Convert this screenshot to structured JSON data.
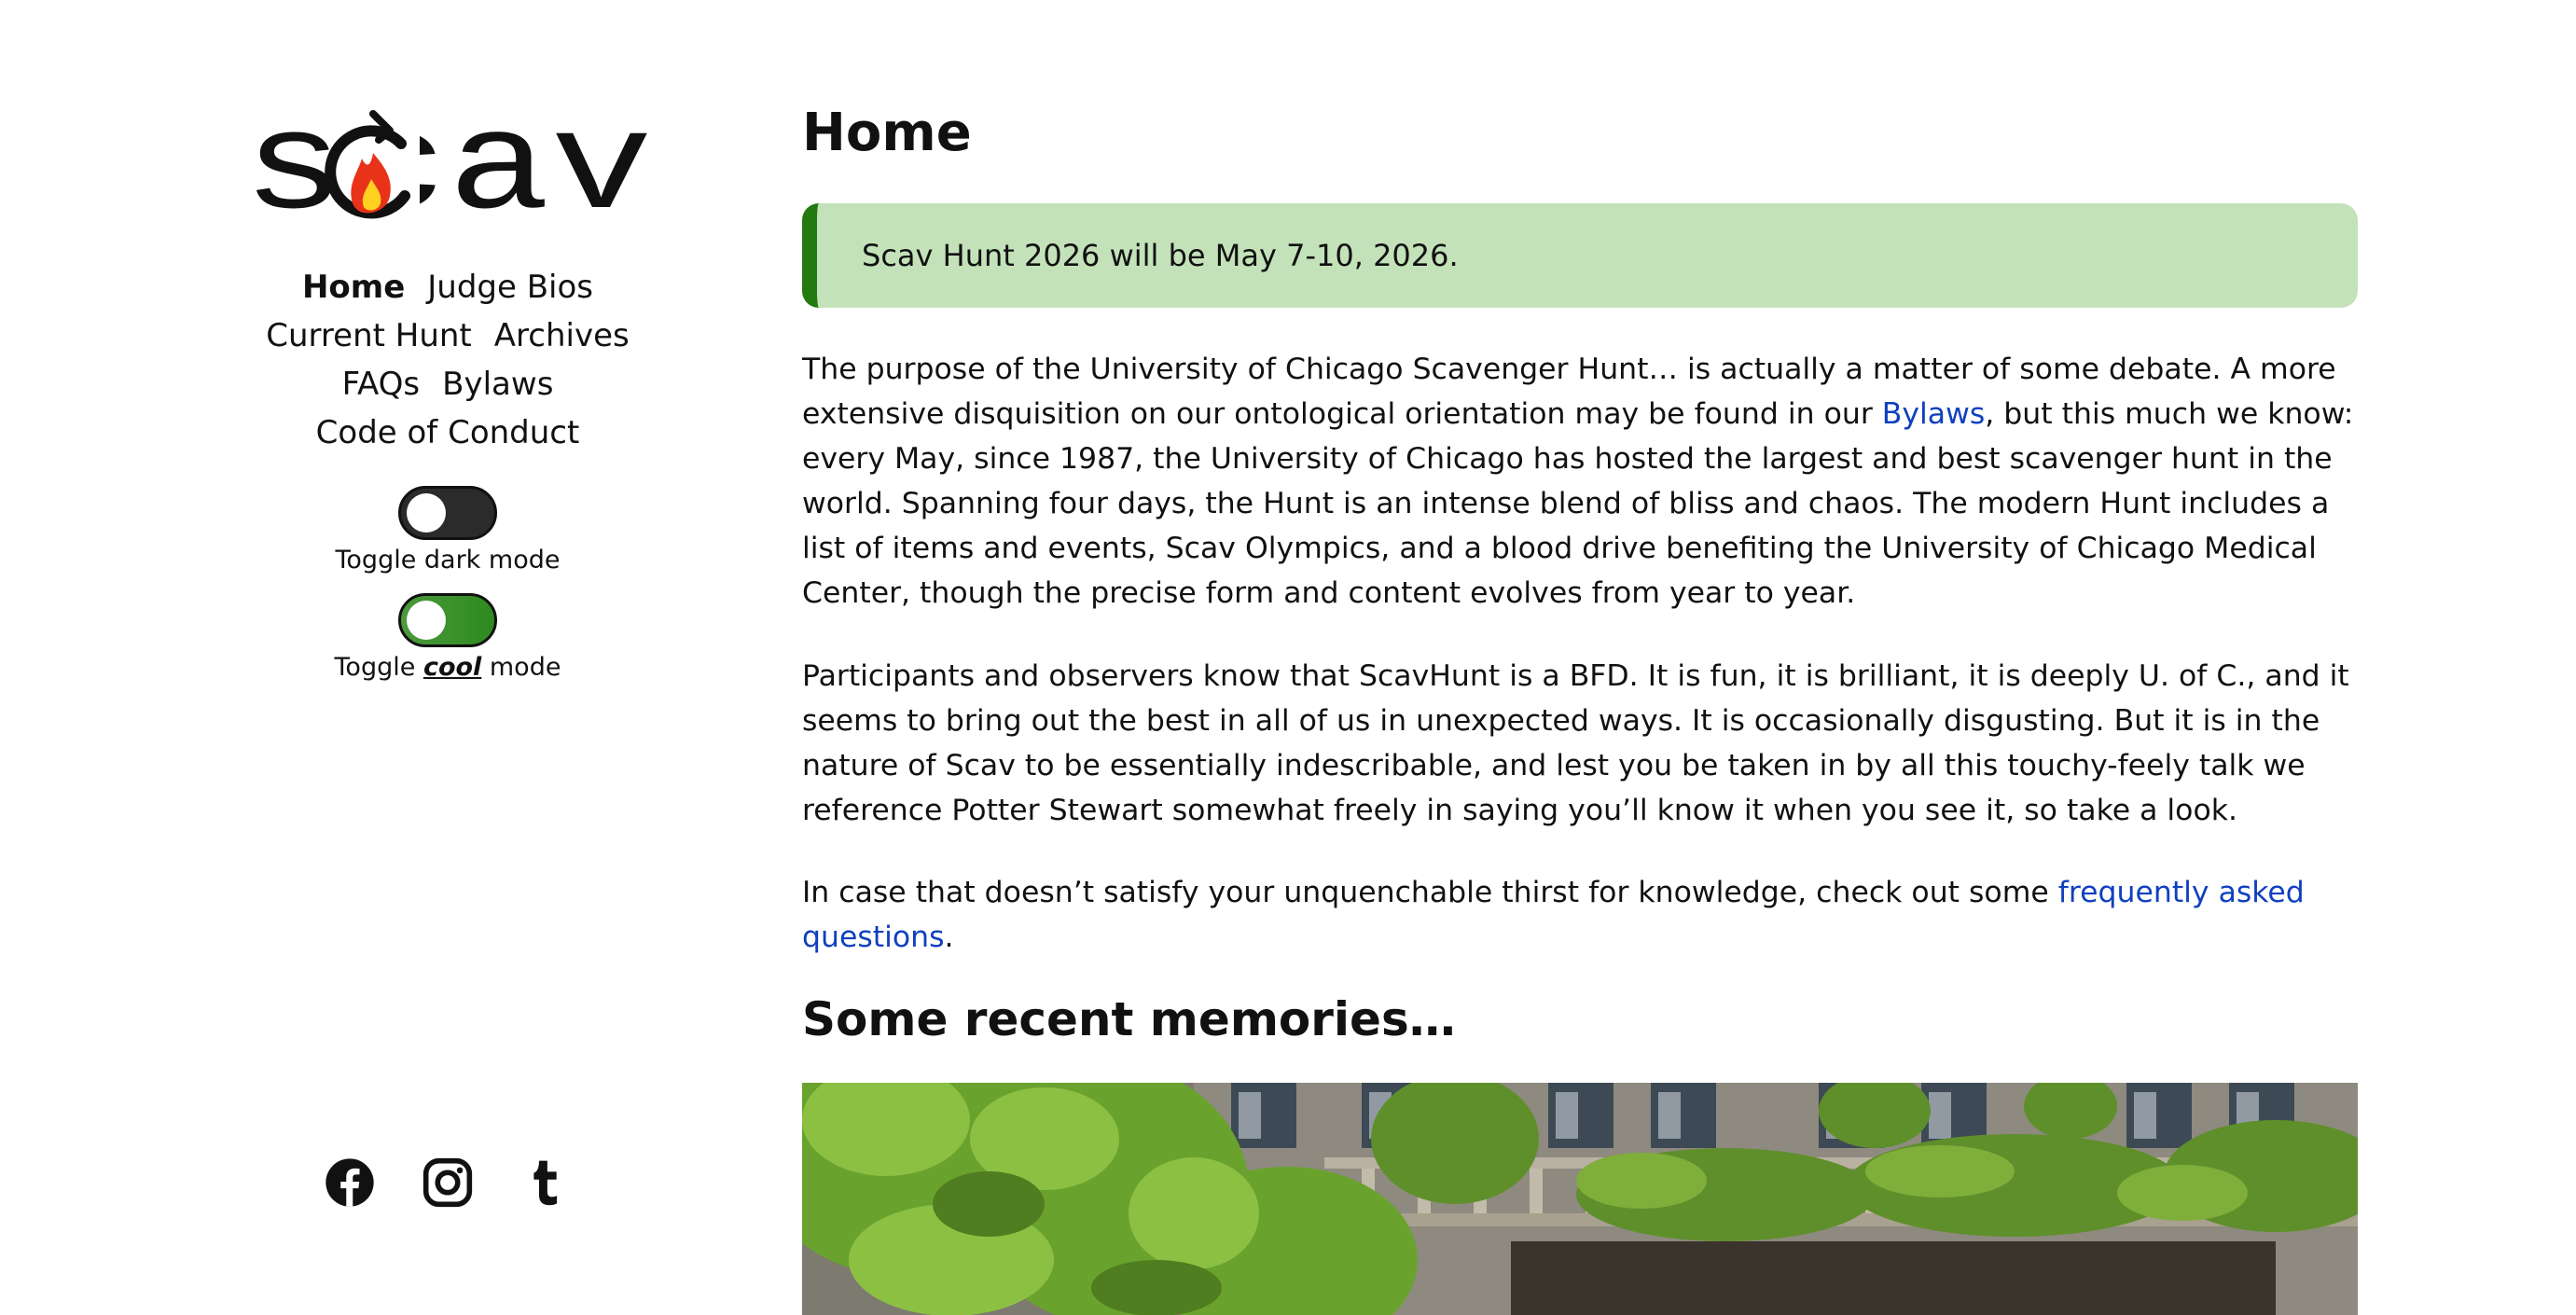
{
  "sidebar": {
    "logo_text": "scav",
    "nav": {
      "home": "Home",
      "judge_bios": "Judge Bios",
      "current_hunt": "Current Hunt",
      "archives": "Archives",
      "faqs": "FAQs",
      "bylaws": "Bylaws",
      "code_of_conduct": "Code of Conduct"
    },
    "dark_toggle_label": "Toggle dark mode",
    "cool_toggle": {
      "prefix": "Toggle ",
      "emphasis": "cool",
      "suffix": " mode"
    },
    "social_icons": [
      "facebook-icon",
      "instagram-icon",
      "tumblr-icon"
    ]
  },
  "main": {
    "title": "Home",
    "notice": "Scav Hunt 2026 will be May 7-10, 2026.",
    "p1": {
      "before_link": "The purpose of the University of Chicago Scavenger Hunt… is actually a matter of some debate. A more extensive disquisition on our ontological orientation may be found in our ",
      "link": "Bylaws",
      "after_link": ", but this much we know: every May, since 1987, the University of Chicago has hosted the largest and best scavenger hunt in the world. Spanning four days, the Hunt is an intense blend of bliss and chaos. The modern Hunt includes a list of items and events, Scav Olympics, and a blood drive benefiting the University of Chicago Medical Center, though the precise form and content evolves from year to year."
    },
    "p2": "Participants and observers know that ScavHunt is a BFD. It is fun, it is brilliant, it is deeply U. of C., and it seems to bring out the best in all of us in unexpected ways. It is occasionally disgusting. But it is in the nature of Scav to be essentially indescribable, and lest you be taken in by all this touchy-feely talk we reference Potter Stewart somewhat freely in saying you’ll know it when you see it, so take a look.",
    "p3": {
      "before_link": "In case that doesn’t satisfy your unquenchable thirst for knowledge, check out some ",
      "link": "frequently asked questions",
      "after_link": "."
    },
    "memories_heading": "Some recent memories…"
  },
  "colors": {
    "notice_bg": "#c4e2b9",
    "notice_border": "#237a10",
    "link": "#1040c0",
    "cool_toggle": "#2d8a1e"
  }
}
